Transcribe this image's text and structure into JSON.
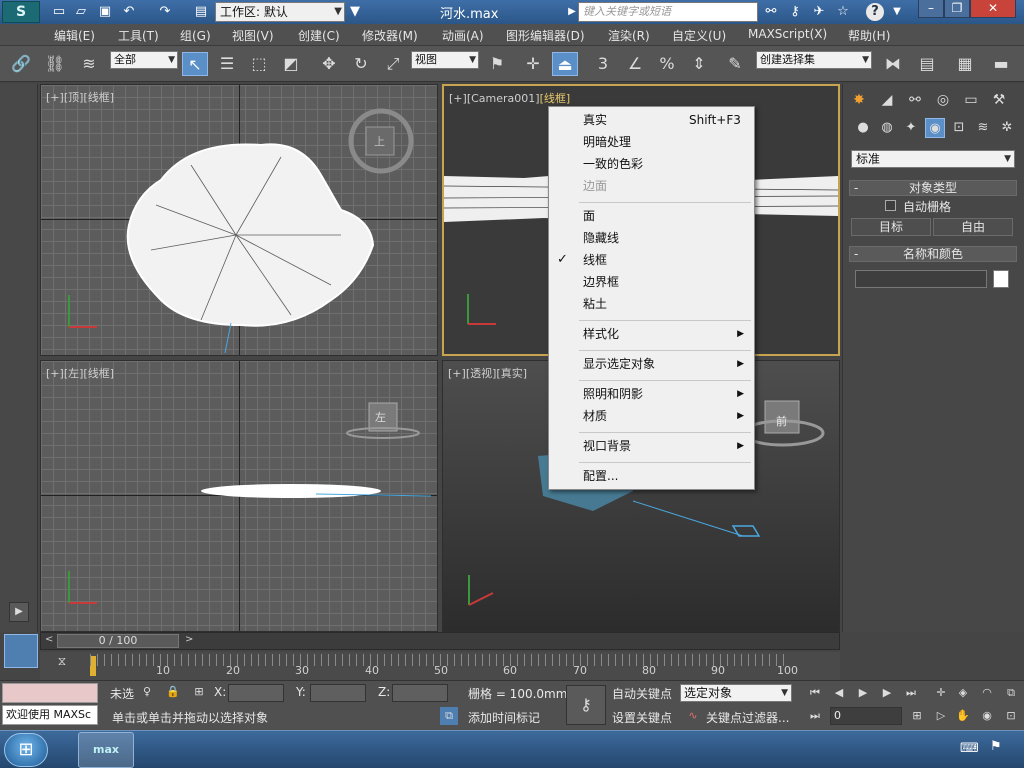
{
  "app": {
    "logo_text": "S",
    "window_title": "河水.max"
  },
  "titlebar": {
    "workspace": "工作区: 默认",
    "search_placeholder": "键入关键字或短语",
    "help_glyph": "?"
  },
  "menu": [
    "编辑(E)",
    "工具(T)",
    "组(G)",
    "视图(V)",
    "创建(C)",
    "修改器(M)",
    "动画(A)",
    "图形编辑器(D)",
    "渲染(R)",
    "自定义(U)",
    "MAXScript(X)",
    "帮助(H)"
  ],
  "toolbar": {
    "filter_select": "全部",
    "ref_coord_select": "视图",
    "named_selection": "创建选择集",
    "snap_3": "3",
    "percent": "%"
  },
  "viewports": {
    "top": {
      "plus": "[+]",
      "name": "[顶]",
      "mode": "[线框]",
      "cube_label": "上"
    },
    "camera": {
      "plus": "[+]",
      "name": "[Camera001]",
      "mode": "[线框]"
    },
    "left": {
      "plus": "[+]",
      "name": "[左]",
      "mode": "[线框]",
      "cube_label": "左"
    },
    "persp": {
      "plus": "[+]",
      "name": "[透视]",
      "mode": "[真实]",
      "cube_label": "前"
    }
  },
  "context_menu": {
    "items": [
      {
        "label": "真实",
        "shortcut": "Shift+F3"
      },
      {
        "label": "明暗处理"
      },
      {
        "label": "一致的色彩"
      },
      {
        "label": "边面"
      },
      {
        "label": "面"
      },
      {
        "label": "隐藏线"
      },
      {
        "label": "线框",
        "checked": "✓"
      },
      {
        "label": "边界框"
      },
      {
        "label": "粘土"
      },
      {
        "label": "样式化"
      },
      {
        "label": "显示选定对象"
      },
      {
        "label": "照明和阴影"
      },
      {
        "label": "材质"
      },
      {
        "label": "视口背景"
      },
      {
        "label": "配置..."
      }
    ],
    "submenu_arrow": "▶"
  },
  "command_panel": {
    "dropdown": "标准",
    "object_type_title": "对象类型",
    "auto_grid": "自动栅格",
    "btn_target": "目标",
    "btn_free": "自由",
    "name_color_title": "名称和颜色",
    "rollout_minus": "-"
  },
  "timeline": {
    "frame_display": "0 / 100",
    "ticks": [
      "10",
      "20",
      "30",
      "40",
      "50",
      "60",
      "70",
      "80",
      "90",
      "100"
    ]
  },
  "status": {
    "maxscript_label": "欢迎使用 MAXSc",
    "unselected_label": "未选",
    "x_label": "X:",
    "y_label": "Y:",
    "z_label": "Z:",
    "grid_label": "栅格 = 100.0mm",
    "prompt": "单击或单击并拖动以选择对象",
    "add_time_tag": "添加时间标记",
    "auto_key": "自动关键点",
    "set_key": "设置关键点",
    "key_mode_select": "选定对象",
    "key_filters": "关键点过滤器...",
    "frame_field": "0"
  },
  "taskbar": {
    "task_label": "max"
  }
}
